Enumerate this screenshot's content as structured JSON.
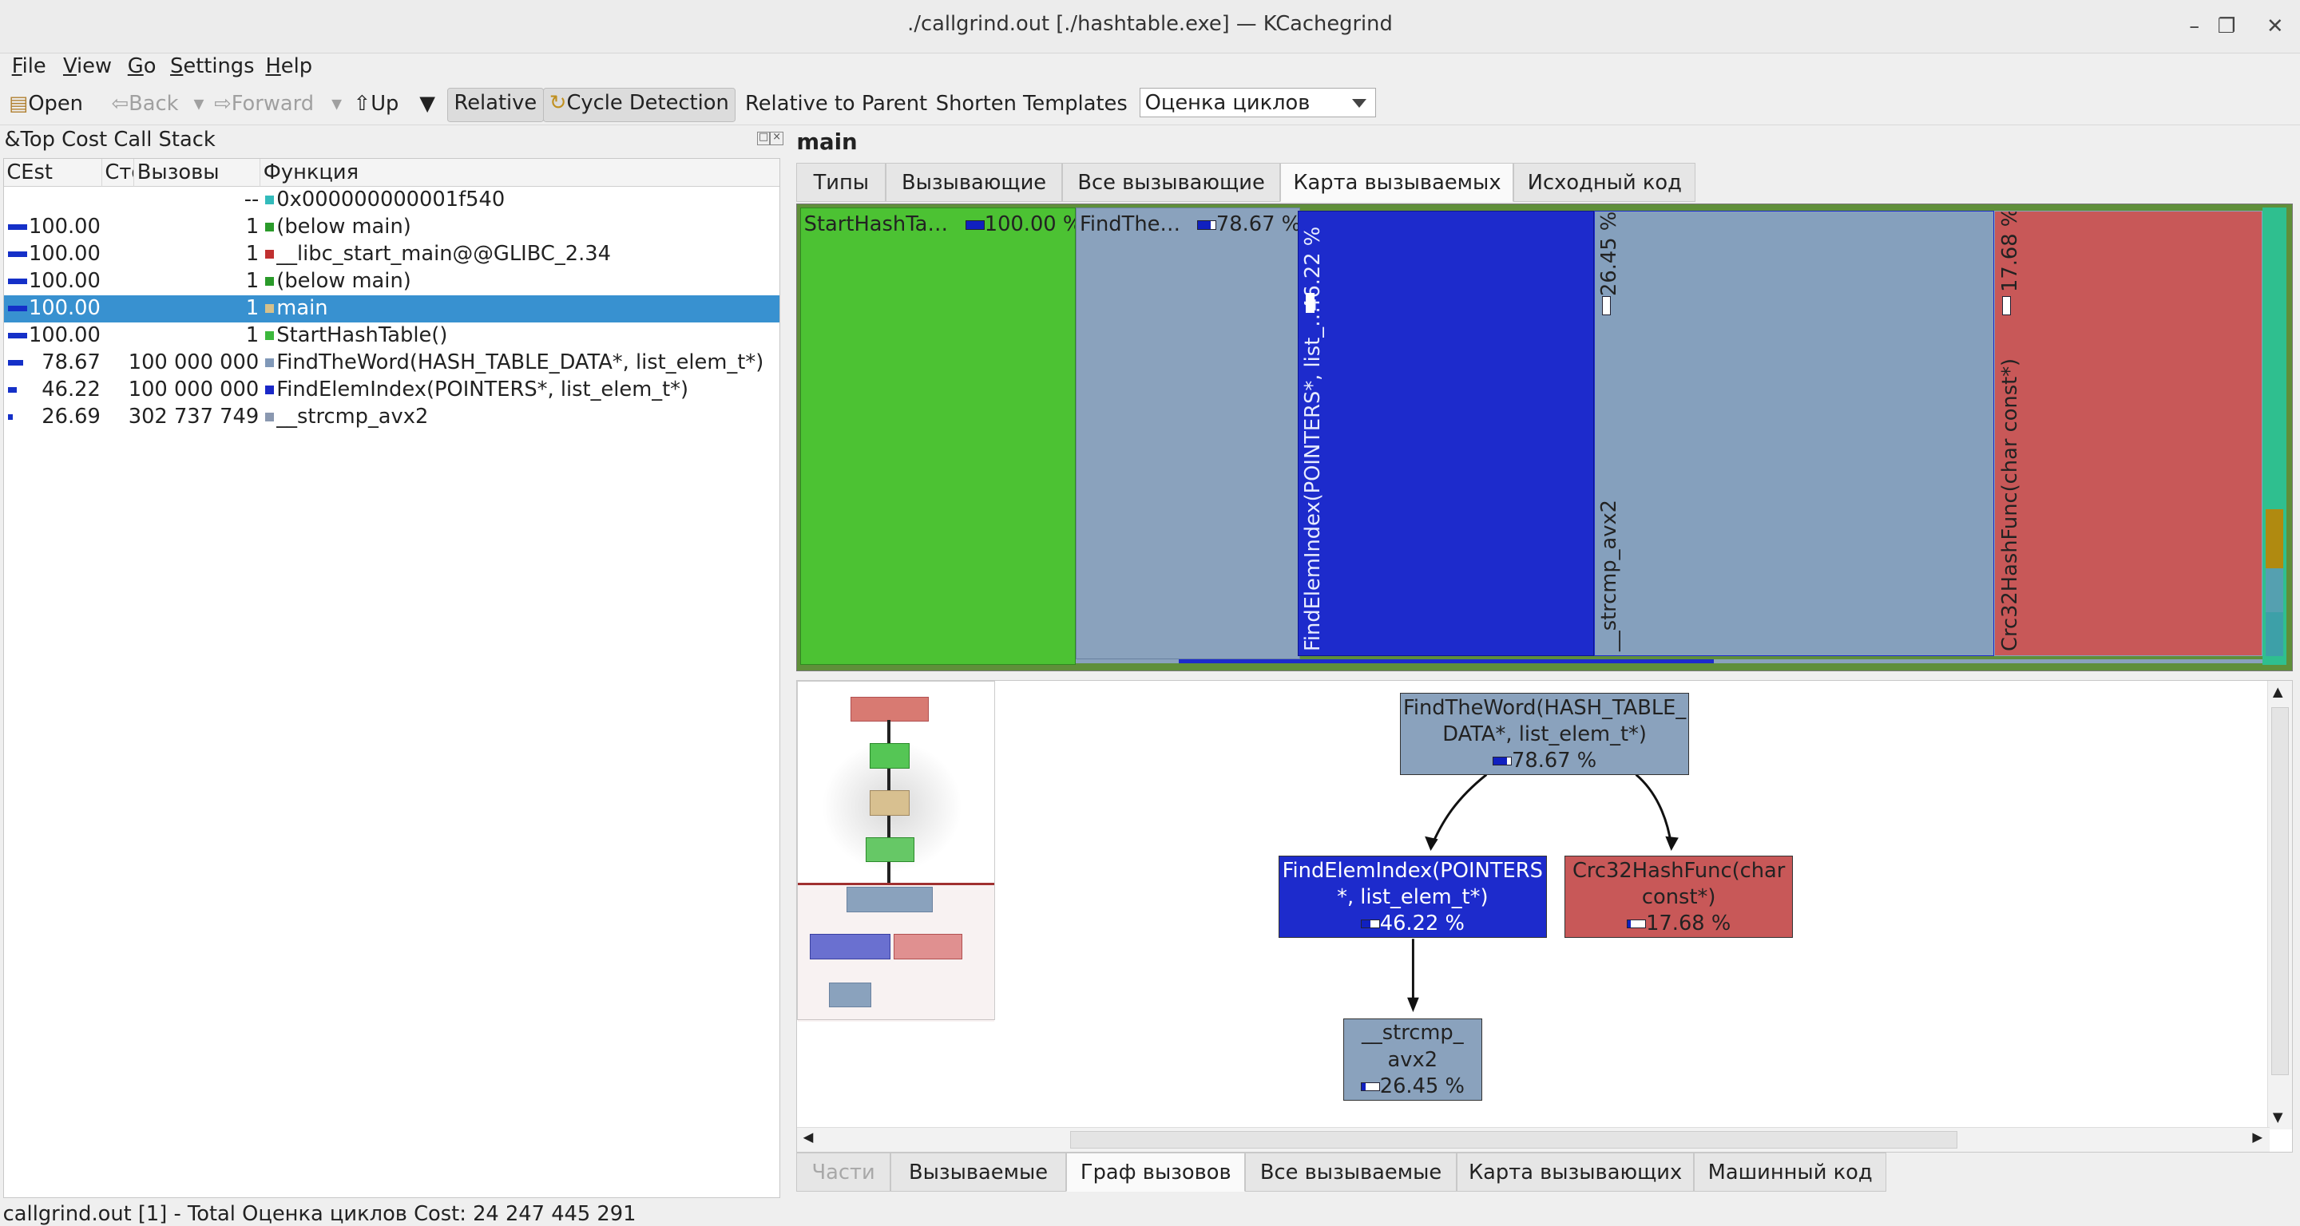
{
  "window": {
    "title": "./callgrind.out [./hashtable.exe] — KCachegrind"
  },
  "menu": [
    {
      "label": "File",
      "ul": "F",
      "rest": "ile"
    },
    {
      "label": "View",
      "ul": "V",
      "rest": "iew"
    },
    {
      "label": "Go",
      "ul": "G",
      "rest": "o"
    },
    {
      "label": "Settings",
      "ul": "S",
      "rest": "ettings"
    },
    {
      "label": "Help",
      "ul": "H",
      "rest": "elp"
    }
  ],
  "toolbar": {
    "open": "Open",
    "back": "Back",
    "forward": "Forward",
    "up": "Up",
    "relative": "Relative",
    "cycle_detection": "Cycle Detection",
    "relative_to_parent": "Relative to Parent",
    "shorten_templates": "Shorten Templates",
    "event_combo": "Оценка циклов"
  },
  "stack_panel": {
    "title": "&Top Cost Call Stack",
    "columns": [
      "CEst",
      "Сто",
      "Вызовы",
      "Функция"
    ],
    "rows": [
      {
        "cost": "",
        "calls": "--",
        "func": "0x000000000001f540",
        "color": "#33bbbb",
        "bar": 0,
        "selected": false
      },
      {
        "cost": "100.00",
        "calls": "1",
        "func": "(below main)",
        "color": "#2a9a2a",
        "bar": 1.0,
        "selected": false
      },
      {
        "cost": "100.00",
        "calls": "1",
        "func": "__libc_start_main@@GLIBC_2.34",
        "color": "#c03030",
        "bar": 1.0,
        "selected": false
      },
      {
        "cost": "100.00",
        "calls": "1",
        "func": "(below main)",
        "color": "#2a9a2a",
        "bar": 1.0,
        "selected": false
      },
      {
        "cost": "100.00",
        "calls": "1",
        "func": "main",
        "color": "#d6c08a",
        "bar": 1.0,
        "selected": true
      },
      {
        "cost": "100.00",
        "calls": "1",
        "func": "StartHashTable()",
        "color": "#3cb83c",
        "bar": 1.0,
        "selected": false
      },
      {
        "cost": "78.67",
        "calls": "100 000 000",
        "func": "FindTheWord(HASH_TABLE_DATA*, list_elem_t*)",
        "color": "#8098b8",
        "bar": 0.7867,
        "selected": false
      },
      {
        "cost": "46.22",
        "calls": "100 000 000",
        "func": "FindElemIndex(POINTERS*, list_elem_t*)",
        "color": "#1a28c8",
        "bar": 0.4622,
        "selected": false
      },
      {
        "cost": "26.69",
        "calls": "302 737 749",
        "func": "__strcmp_avx2",
        "color": "#8a98b0",
        "bar": 0.2669,
        "selected": false
      }
    ]
  },
  "main_label": "main",
  "top_tabs": [
    "Типы",
    "Вызывающие",
    "Все вызывающие",
    "Карта вызываемых",
    "Исходный код"
  ],
  "top_tab_active": 3,
  "treemap": {
    "start_hash": {
      "label": "StartHashTa…",
      "pct": "100.00 %",
      "value": 1.0
    },
    "find_the_word": {
      "label": "FindThe…",
      "pct": "78.67 %",
      "value": 0.7867
    },
    "find_elem_index": {
      "label": "FindElemIndex(POINTERS*, list_…",
      "pct": "46.22 %",
      "value": 0.4622
    },
    "strcmp": {
      "label": "__strcmp_avx2",
      "pct": "26.45 %",
      "value": 0.2645
    },
    "crc32": {
      "label": "Crc32HashFunc(char const*)",
      "pct": "17.68 %",
      "value": 0.1768
    }
  },
  "graph": {
    "nodes": {
      "find_the_word": {
        "line1": "FindTheWord(HASH_TABLE_",
        "line2": "DATA*, list_elem_t*)",
        "pct": "78.67 %",
        "value": 0.7867
      },
      "find_elem_index": {
        "line1": "FindElemIndex(POINTERS",
        "line2": "*, list_elem_t*)",
        "pct": "46.22 %",
        "value": 0.4622
      },
      "crc32": {
        "line1": "Crc32HashFunc(char",
        "line2": "const*)",
        "pct": "17.68 %",
        "value": 0.1768
      },
      "strcmp": {
        "line1": "__strcmp_",
        "line2": "avx2",
        "pct": "26.45 %",
        "value": 0.2645
      }
    }
  },
  "bottom_tabs": [
    "Части",
    "Вызываемые",
    "Граф вызовов",
    "Все вызываемые",
    "Карта вызывающих",
    "Машинный код"
  ],
  "bottom_tab_active": 2,
  "status": "callgrind.out [1] - Total Оценка циклов Cost: 24 247 445 291"
}
